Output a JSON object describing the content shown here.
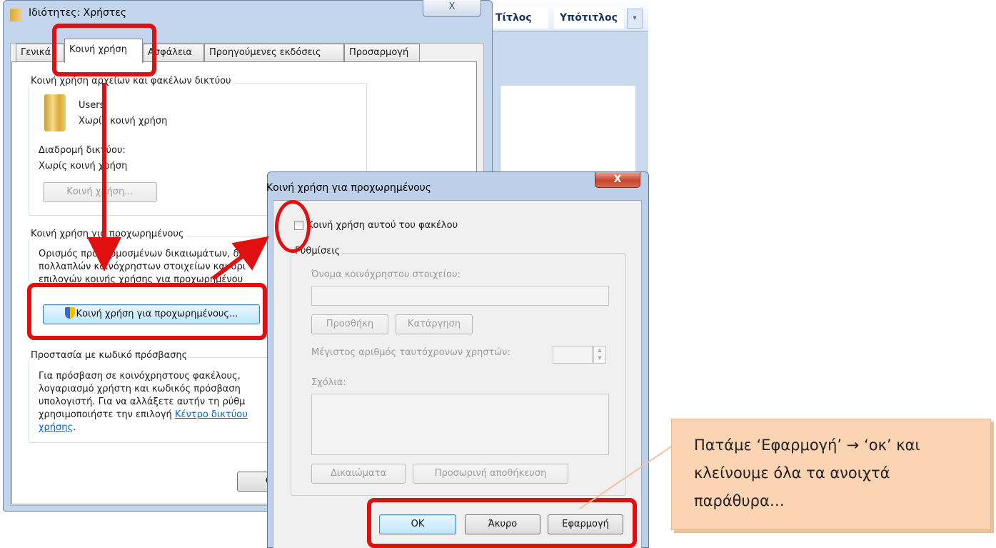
{
  "background_window": {
    "style_title": "Τίτλος",
    "style_subtitle": "Υπότιτλος"
  },
  "properties_dialog": {
    "title": "Ιδιότητες: Χρήστες",
    "close_label": "X",
    "tabs": [
      {
        "label": "Γενικά"
      },
      {
        "label": "Κοινή χρήση"
      },
      {
        "label": "Ασφάλεια"
      },
      {
        "label": "Προηγούμενες εκδόσεις"
      },
      {
        "label": "Προσαρμογή"
      }
    ],
    "network_group": {
      "label": "Κοινή χρήση αρχείων και φακέλων δικτύου",
      "folder_name": "Users",
      "folder_status": "Χωρίς κοινή χρήση",
      "network_path_label": "Διαδρομή δικτύου:",
      "network_path_value": "Χωρίς κοινή χρήση",
      "share_button": "Κοινή χρήση..."
    },
    "advanced_group": {
      "label": "Κοινή χρήση για προχωρημένους",
      "description_line1": "Ορισμός προσαρμοσμένων δικαιωμάτων, δη",
      "description_line2": "πολλαπλών κοινόχρηστων στοιχείων και ορι",
      "description_line3": "επιλογών κοινής χρήσης για προχωρημένου",
      "button": "Κοινή χρήση για προχωρημένους..."
    },
    "password_group": {
      "label": "Προστασία με κωδικό πρόσβασης",
      "line1": "Για πρόσβαση σε κοινόχρηστους φακέλους,",
      "line2": "λογαριασμό χρήστη και κωδικός πρόσβαση",
      "line3": "υπολογιστή. Για να αλλάξετε αυτήν τη ρύθμ",
      "line4_prefix": "χρησιμοποιήστε την επιλογή ",
      "line4_link": "Κέντρο δικτύου",
      "line5_link": "χρήσης",
      "line5_suffix": "."
    },
    "bottom_button_partial": "C"
  },
  "advanced_dialog": {
    "title": "Κοινή χρήση για προχωρημένους",
    "close_label": "X",
    "share_checkbox_label": "Κοινή χρήση αυτού του φακέλου",
    "share_checked": false,
    "settings_label": "Ρυθμίσεις",
    "share_name_label": "Όνομα κοινόχρηστου στοιχείου:",
    "share_name_value": "",
    "add_button": "Προσθήκη",
    "remove_button": "Κατάργηση",
    "max_users_label": "Μέγιστος αριθμός ταυτόχρονων χρηστών:",
    "max_users_value": "",
    "comments_label": "Σχόλια:",
    "comments_value": "",
    "permissions_button": "Δικαιώματα",
    "caching_button": "Προσωρινή αποθήκευση",
    "ok_button": "OK",
    "cancel_button": "Άκυρο",
    "apply_button": "Εφαρμογή"
  },
  "annotation": {
    "callout_text": "Πατάμε ‘Εφαρμογή’ → ‘οκ’  και\nκλείνουμε όλα τα ανοιχτά\nπαράθυρα…",
    "highlight_color": "#e01010",
    "callout_fill": "#fbd4b4"
  }
}
